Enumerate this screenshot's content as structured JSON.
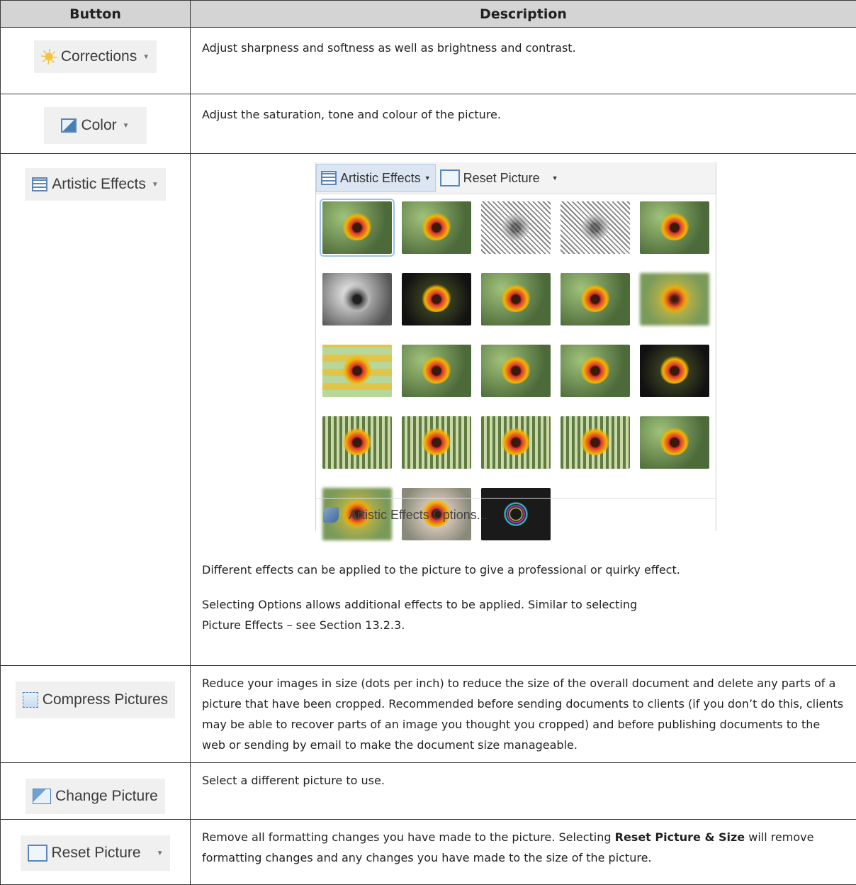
{
  "headers": {
    "button": "Button",
    "description": "Description"
  },
  "rows": [
    {
      "button": {
        "label": "Corrections",
        "icon": "sun-icon"
      },
      "description": "Adjust sharpness and softness as well as brightness and contrast."
    },
    {
      "button": {
        "label": "Color",
        "icon": "picture-icon"
      },
      "description": "Adjust the saturation, tone and colour of the picture."
    },
    {
      "button": {
        "label": "Artistic Effects",
        "icon": "artistic-effects-icon"
      },
      "gallery": {
        "tab_artistic": "Artistic Effects",
        "tab_reset": "Reset Picture",
        "options_label": "Artistic Effects Options..."
      },
      "description_1": "Different effects can be applied to the picture to give a professional or quirky effect.",
      "description_2": "Selecting Options allows additional effects to be applied. Similar to selecting Picture Effects – see Section 13.2.3."
    },
    {
      "button": {
        "label": "Compress Pictures",
        "icon": "compress-icon"
      },
      "description": "Reduce your images in size (dots per inch) to reduce the size of the overall document and delete any parts of a picture that have been cropped. Recommended before sending documents to clients (if you don’t do this, clients may be able to recover parts of an image you thought you cropped) and before publishing documents to the web or sending by email to make the document size manageable."
    },
    {
      "button": {
        "label": "Change Picture",
        "icon": "change-picture-icon"
      },
      "description": "Select a different picture to use."
    },
    {
      "button": {
        "label": "Reset Picture",
        "icon": "reset-picture-icon"
      },
      "description_pre": "Remove all formatting changes you have made to the picture. Selecting ",
      "description_bold": "Reset Picture & Size",
      "description_post": " will remove formatting changes and any changes you have made to the size of the picture."
    }
  ]
}
